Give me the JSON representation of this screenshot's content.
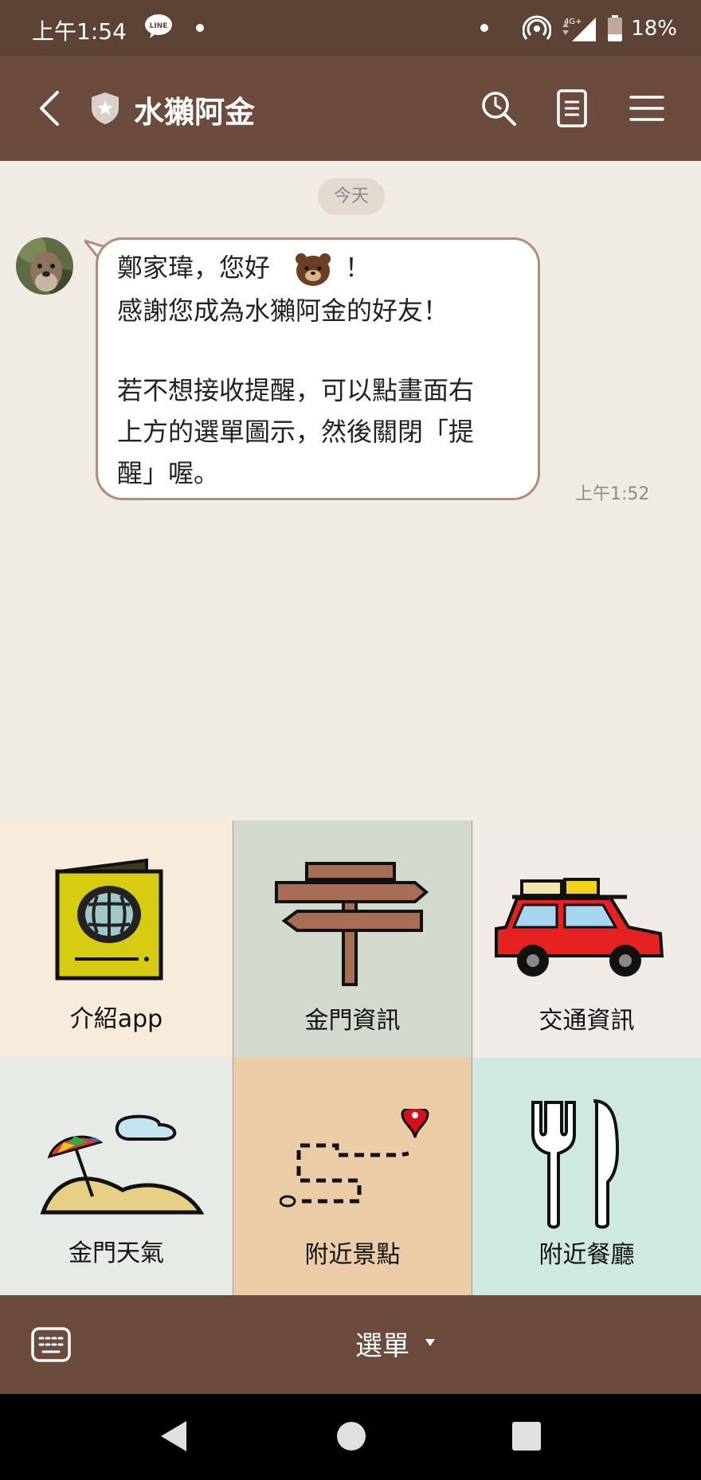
{
  "status_bar": {
    "time": "上午1:54",
    "battery": "18%",
    "network": "4G+",
    "icons": [
      "line-icon",
      "hotspot-icon",
      "signal-icon",
      "battery-icon"
    ]
  },
  "header": {
    "title": "水獺阿金",
    "icons": [
      "back-icon",
      "shield-icon",
      "search-icon",
      "notes-icon",
      "menu-icon"
    ]
  },
  "chat": {
    "date_label": "今天",
    "message": {
      "lines": [
        "鄭家瑋，您好",
        "！",
        "感謝您成為水獺阿金的好友！",
        "若不想接收提醒，可以點畫面右",
        "上方的選單圖示，然後關閉「提",
        "醒」喔。"
      ],
      "emoji": "bear-emoji",
      "time": "上午1:52"
    }
  },
  "rich_menu": {
    "items": [
      {
        "label": "介紹app",
        "icon": "passport-icon",
        "bg": "#f7ebdc"
      },
      {
        "label": "金門資訊",
        "icon": "signpost-icon",
        "bg": "#d2d9cf"
      },
      {
        "label": "交通資訊",
        "icon": "car-icon",
        "bg": "#f0ebe6"
      },
      {
        "label": "金門天氣",
        "icon": "beach-umbrella-icon",
        "bg": "#e7ebe5"
      },
      {
        "label": "附近景點",
        "icon": "route-map-icon",
        "bg": "#eccca7"
      },
      {
        "label": "附近餐廳",
        "icon": "fork-knife-icon",
        "bg": "#d0e8e2"
      }
    ]
  },
  "bottom_bar": {
    "menu_label": "選單"
  },
  "colors": {
    "status_bar": "#5d4336",
    "header": "#6b4b3d",
    "chat_bg": "#f1ebe5",
    "bubble_border": "#b08e7c"
  }
}
